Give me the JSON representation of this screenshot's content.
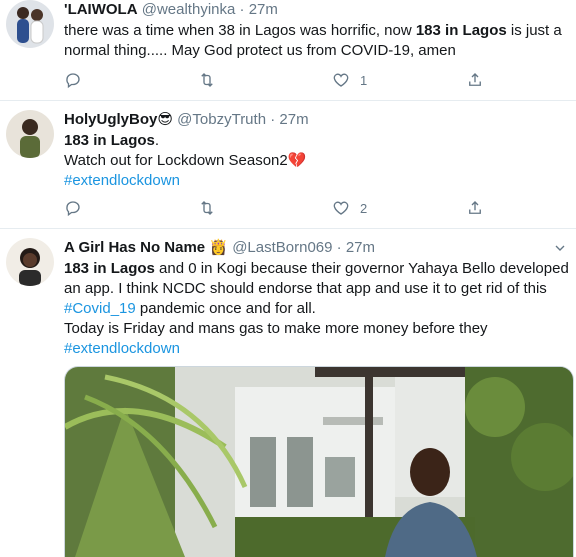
{
  "tweets": [
    {
      "name": "'LAIWOLA",
      "handle": "@wealthyinka",
      "dot": "·",
      "time": "27m",
      "text_line1_a": "there was a time when 38 in Lagos was horrific, now ",
      "text_line1_b": "183 in Lagos",
      "text_line1_c": " is just a",
      "text_line2": "normal thing.....  May God protect us from COVID-19, amen",
      "likes": "1"
    },
    {
      "name": "HolyUglyBoy",
      "name_emoji": "😎",
      "handle": "@TobzyTruth",
      "dot": "·",
      "time": "27m",
      "line1": "183 in Lagos",
      "line1_suffix": ".",
      "line2": "Watch out for Lockdown Season2",
      "line2_emoji": "💔",
      "line3": "#extendlockdown",
      "likes": "2"
    },
    {
      "name": "A Girl Has No Name",
      "name_emoji": "👸",
      "handle": "@LastBorn069",
      "dot": "·",
      "time": "27m",
      "line1_bold": "183 in Lagos",
      "line1_rest": " and 0 in Kogi because their governor Yahaya Bello developed",
      "line2": "an app. I think NCDC should endorse that app and use it to get rid of this",
      "line3_tag": "#Covid_19",
      "line3_rest": " pandemic once and for all.",
      "line4": "Today is Friday and mans gas to make more money before they",
      "line5": "#extendlockdown"
    }
  ],
  "colors": {
    "link": "#1b95e0",
    "muted": "#657786",
    "text": "#14171a"
  },
  "icons": [
    "reply-icon",
    "retweet-icon",
    "like-icon",
    "share-icon",
    "chevron-down-icon"
  ]
}
